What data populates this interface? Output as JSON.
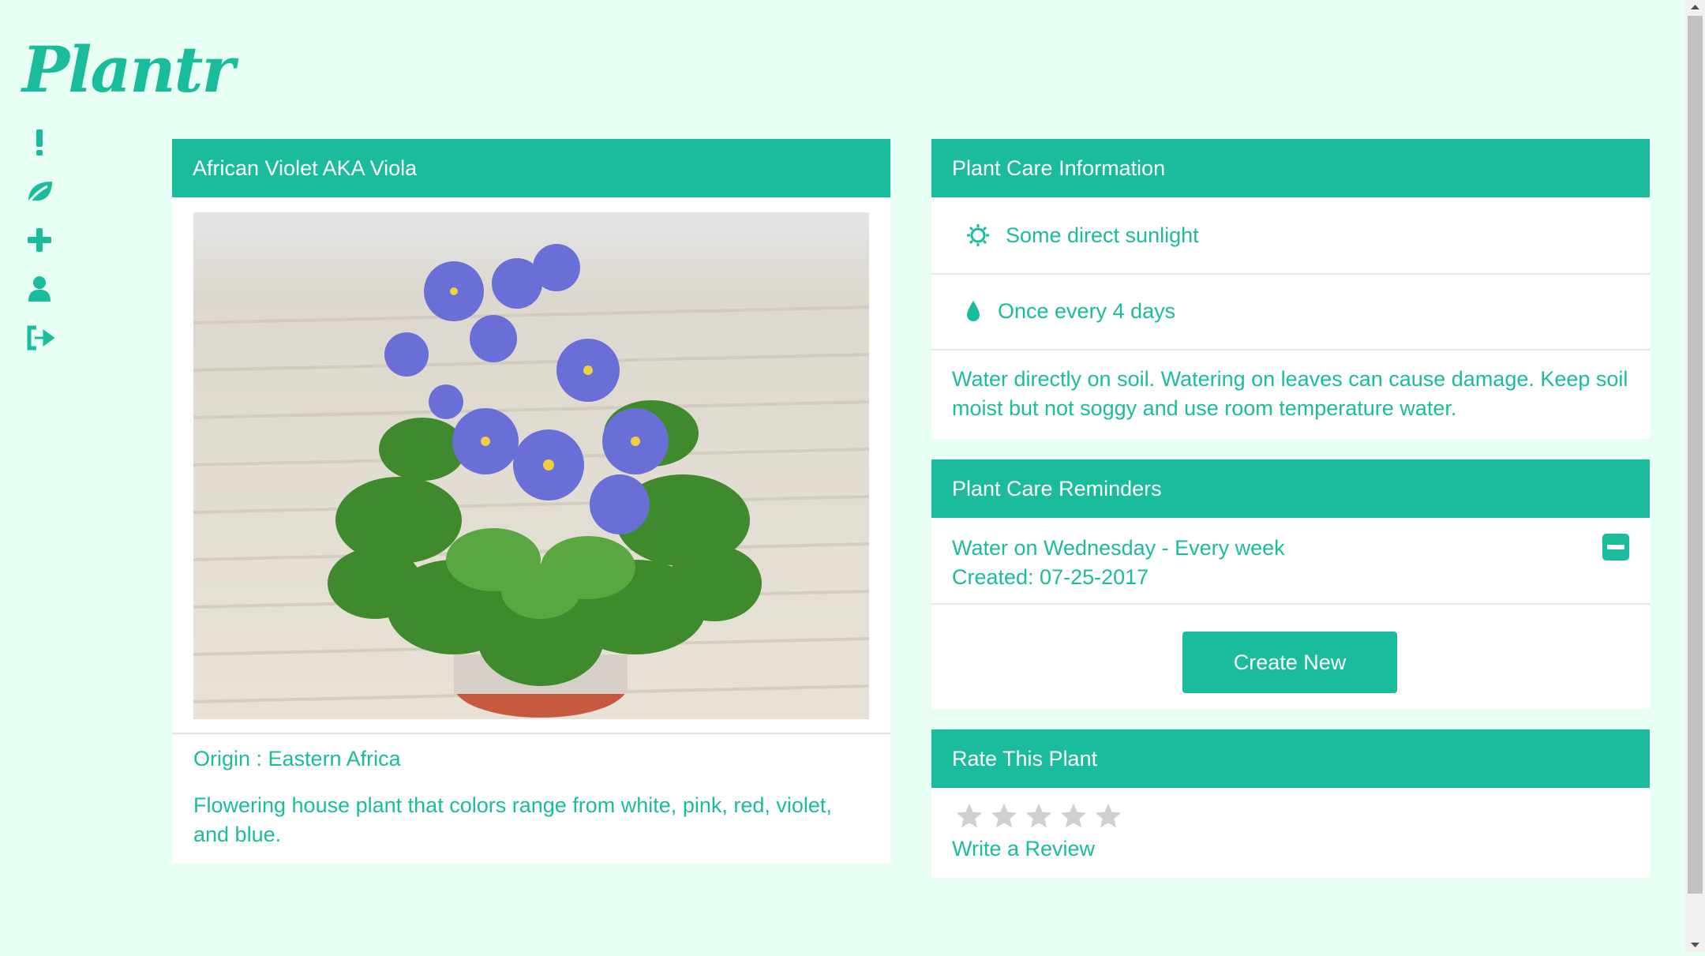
{
  "app": {
    "logo": "Plantr"
  },
  "sidebar": {
    "items": [
      {
        "icon": "exclamation-icon"
      },
      {
        "icon": "leaf-icon"
      },
      {
        "icon": "plus-icon"
      },
      {
        "icon": "user-icon"
      },
      {
        "icon": "sign-out-icon"
      }
    ]
  },
  "plant": {
    "title": "African Violet AKA Viola",
    "origin": "Origin : Eastern Africa",
    "description": "Flowering house plant that colors range from white, pink, red, violet, and blue."
  },
  "care": {
    "title": "Plant Care Information",
    "sunlight": "Some direct sunlight",
    "watering": "Once every 4 days",
    "note": "Water directly on soil. Watering on leaves can cause damage. Keep soil moist but not soggy and use room temperature water."
  },
  "reminders": {
    "title": "Plant Care Reminders",
    "items": [
      {
        "text": "Water on Wednesday - Every week",
        "created": "Created: 07-25-2017"
      }
    ],
    "create_label": "Create New"
  },
  "rating": {
    "title": "Rate This Plant",
    "stars_max": 5,
    "stars_value": 0,
    "review_label": "Write a Review"
  },
  "colors": {
    "accent": "#1abc9c",
    "background": "#e8fff3",
    "star_empty": "#d0d0d0"
  }
}
